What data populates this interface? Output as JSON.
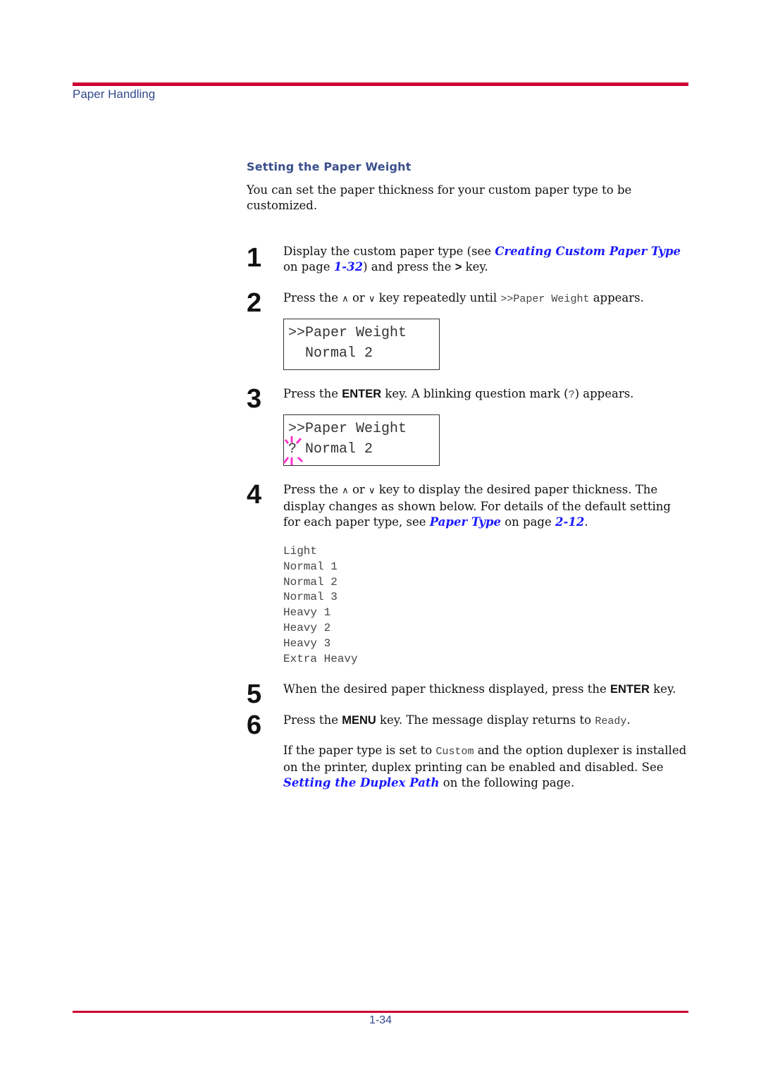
{
  "header": {
    "title": "Paper Handling"
  },
  "section": {
    "heading": "Setting the Paper Weight",
    "intro": "You can set the paper thickness for your custom paper type to be customized."
  },
  "steps": [
    {
      "number": "1",
      "text_a": "Display the custom paper type (see ",
      "link_a": "Creating Custom Paper Type",
      "text_b": " on page ",
      "link_b": "1-32",
      "text_c": ") and press the ",
      "key": ">",
      "text_d": " key."
    },
    {
      "number": "2",
      "text_a": "Press the ",
      "up_icon": "∧",
      "text_b": " or ",
      "down_icon": "∨",
      "text_c": " key repeatedly until ",
      "mono": ">>Paper Weight",
      "text_d": " appears."
    },
    {
      "number": "3",
      "text_a": "Press the ",
      "key": "ENTER",
      "text_b": " key. A blinking question mark (",
      "mono": "?",
      "text_c": ") appears."
    },
    {
      "number": "4",
      "text_a": "Press the ",
      "up_icon": "∧",
      "text_b": " or ",
      "down_icon": "∨",
      "text_c": " key to display the desired paper thickness. The display changes as shown below. For details of the default setting for each paper type, see ",
      "link_a": "Paper Type",
      "text_d": " on page ",
      "link_b": "2-12",
      "text_e": "."
    },
    {
      "number": "5",
      "text_a": "When the desired paper thickness displayed, press the ",
      "key": "ENTER",
      "text_b": " key."
    },
    {
      "number": "6",
      "text_a": "Press the ",
      "key": "MENU",
      "text_b": " key. The message display returns to ",
      "mono": "Ready",
      "text_c": "."
    }
  ],
  "lcd1": {
    "line1": ">>Paper Weight",
    "line2": "  Normal 2"
  },
  "lcd2": {
    "line1": ">>Paper Weight",
    "line2_prefix": "?",
    "line2": " Normal 2"
  },
  "options": [
    "Light",
    "Normal 1",
    "Normal 2",
    "Normal 3",
    "Heavy 1",
    "Heavy 2",
    "Heavy 3",
    "Extra Heavy"
  ],
  "note": {
    "text_a": "If the paper type is set to ",
    "mono": "Custom",
    "text_b": " and the option duplexer is installed on the printer, duplex printing can be enabled and disabled. See ",
    "link": "Setting the Duplex Path",
    "text_c": " on the following page."
  },
  "footer": {
    "page_number": "1-34"
  },
  "colors": {
    "rule": "#cc0033",
    "heading": "#3a4f8c",
    "link": "#1a1aff",
    "blink": "#ff33cc"
  }
}
